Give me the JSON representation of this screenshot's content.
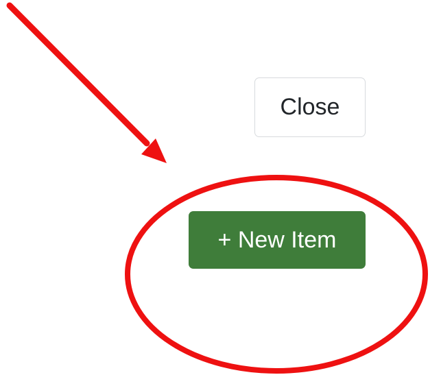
{
  "dialog": {
    "close_label": "Close",
    "new_item_label": "+ New Item"
  },
  "colors": {
    "new_item_button_bg": "#3f7d3a",
    "annotation_red": "#ee1111"
  },
  "annotations": {
    "arrow_icon": "arrow-icon",
    "highlight_icon": "ellipse-highlight-icon"
  }
}
